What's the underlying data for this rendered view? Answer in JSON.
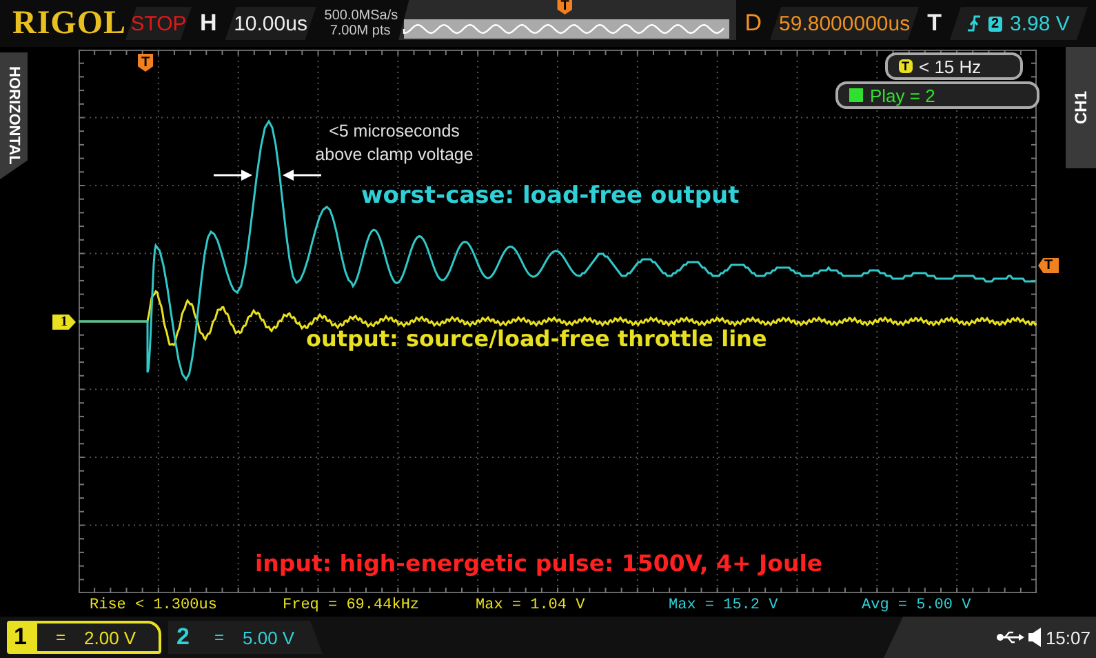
{
  "header": {
    "brand": "RIGOL",
    "run_state": "STOP",
    "timebase_label": "H",
    "timebase": "10.00us",
    "sample_rate": "500.0MSa/s",
    "memory_depth": "7.00M pts",
    "delay_label": "D",
    "delay": "59.8000000us",
    "trigger_label": "T",
    "trigger_source": "2",
    "trigger_level": "3.98 V"
  },
  "side_tabs": {
    "left": "HORIZONTAL",
    "right": "CH1"
  },
  "markers": {
    "overview_trigger": "T",
    "trigger_position": "T",
    "trigger_level": "T",
    "channel": "1"
  },
  "status_pills": [
    {
      "kind": "trigger",
      "badge": "T",
      "text": "< 15 Hz"
    },
    {
      "kind": "play",
      "text": "Play = 2"
    }
  ],
  "annotations": [
    {
      "text": "<5 microseconds above clamp voltage",
      "color": "#e0e0e0"
    },
    {
      "text": "worst-case: load-free output",
      "color": "#30d0d8"
    },
    {
      "text": "output: source/load-free throttle line",
      "color": "#e8e020"
    },
    {
      "text": "input: high-energetic pulse: 1500V, 4+ Joule",
      "color": "#ff2020"
    }
  ],
  "measurements": [
    {
      "text": "Rise < 1.300us",
      "color": "#e8e020"
    },
    {
      "text": "Freq = 69.44kHz",
      "color": "#e8e020"
    },
    {
      "text": "Max = 1.04 V",
      "color": "#e8e020"
    },
    {
      "text": "Max = 15.2 V",
      "color": "#30d0d8"
    },
    {
      "text": "Avg = 5.00 V",
      "color": "#30d0d8"
    }
  ],
  "channels": [
    {
      "number": "1",
      "coupling": "=",
      "scale": "2.00 V",
      "selected": true,
      "color": "#e8e020"
    },
    {
      "number": "2",
      "coupling": "=",
      "scale": "5.00 V",
      "selected": false,
      "color": "#30d0d8"
    }
  ],
  "status": {
    "time": "15:07"
  }
}
